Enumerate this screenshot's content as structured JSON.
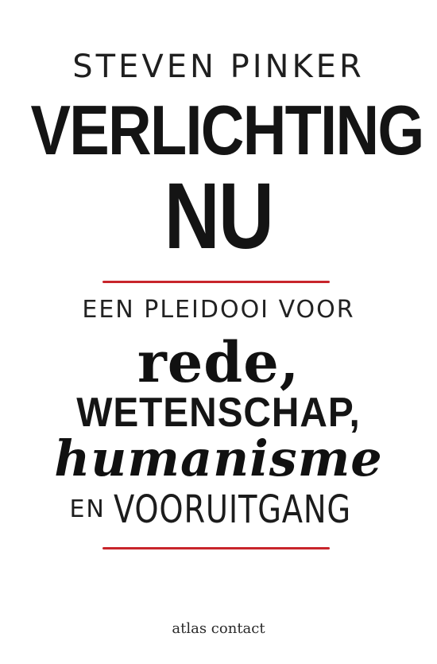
{
  "cover": {
    "author": "STEVEN PINKER",
    "title_line1": "VERLICHTING",
    "title_line2": "NU",
    "subtitle": "EEN PLEIDOOI VOOR",
    "word1": "rede,",
    "word2": "WETENSCHAP,",
    "word3": "humanisme",
    "word4_prefix": "EN",
    "word4": "VOORUITGANG",
    "publisher": "atlas contact"
  },
  "colors": {
    "accent_rule": "#c8252b",
    "ink": "#1a1a1a",
    "background": "#ffffff"
  }
}
